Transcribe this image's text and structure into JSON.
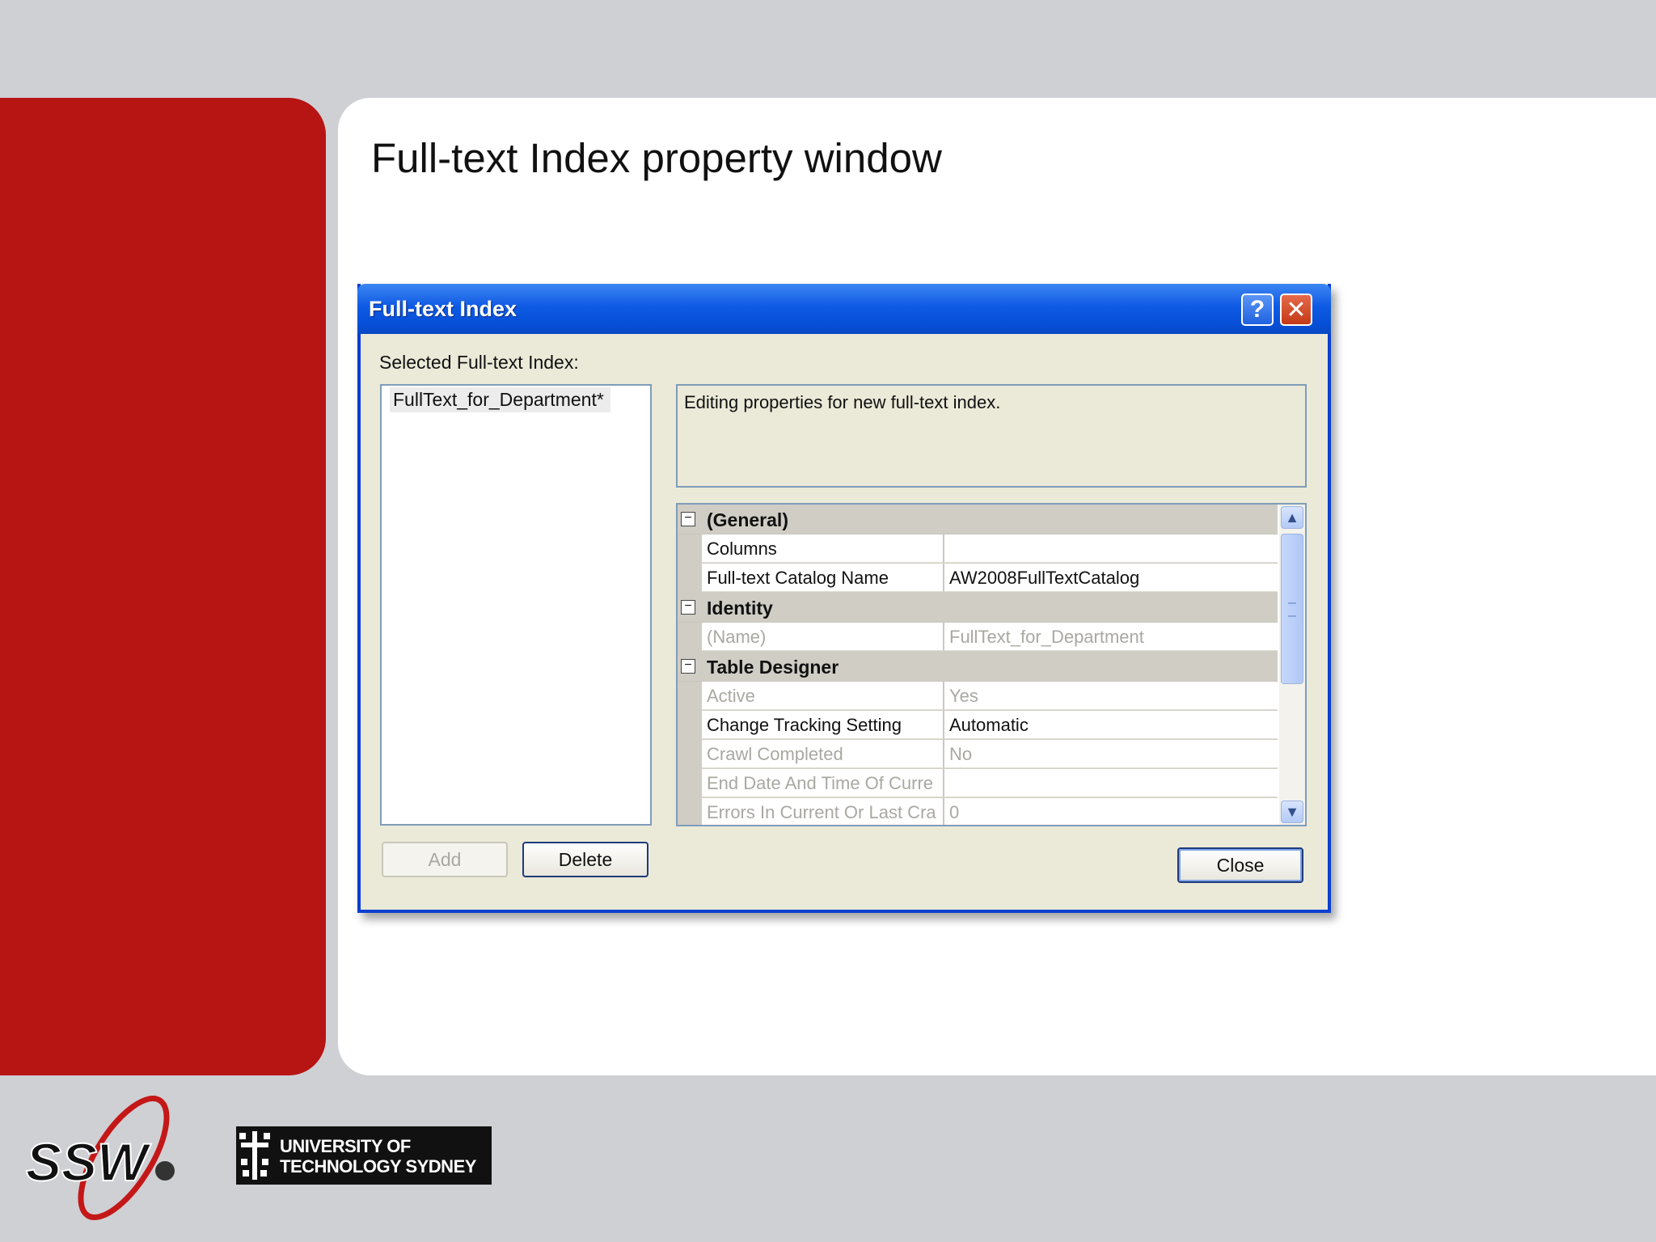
{
  "slide": {
    "title": "Full-text Index property window"
  },
  "dialog": {
    "title": "Full-text Index",
    "help_glyph": "?",
    "close_glyph": "✕",
    "selected_label": "Selected Full-text Index:",
    "selected_item": "FullText_for_Department*",
    "description": "Editing properties for new full-text index.",
    "categories": [
      {
        "name": "(General)",
        "toggle": "−",
        "rows": [
          {
            "name": "Columns",
            "value": "",
            "readonly": false
          },
          {
            "name": "Full-text Catalog Name",
            "value": "AW2008FullTextCatalog",
            "readonly": false
          }
        ]
      },
      {
        "name": "Identity",
        "toggle": "−",
        "rows": [
          {
            "name": "(Name)",
            "value": "FullText_for_Department",
            "readonly": true
          }
        ]
      },
      {
        "name": "Table Designer",
        "toggle": "−",
        "rows": [
          {
            "name": "Active",
            "value": "Yes",
            "readonly": true
          },
          {
            "name": "Change Tracking Setting",
            "value": "Automatic",
            "readonly": false
          },
          {
            "name": "Crawl Completed",
            "value": "No",
            "readonly": true
          },
          {
            "name": "End Date And Time Of Curre",
            "value": "",
            "readonly": true
          },
          {
            "name": "Errors In Current Or Last Cra",
            "value": "0",
            "readonly": true
          }
        ]
      }
    ],
    "buttons": {
      "add": "Add",
      "delete": "Delete",
      "close": "Close"
    },
    "scroll_up_glyph": "▲",
    "scroll_down_glyph": "▼"
  },
  "logos": {
    "ssw": "SSW",
    "uts_line1": "UNIVERSITY OF",
    "uts_line2": "TECHNOLOGY SYDNEY"
  },
  "colors": {
    "brand_red": "#b71414",
    "titlebar_blue": "#0650d8",
    "dialog_bg": "#ebe9d8"
  }
}
